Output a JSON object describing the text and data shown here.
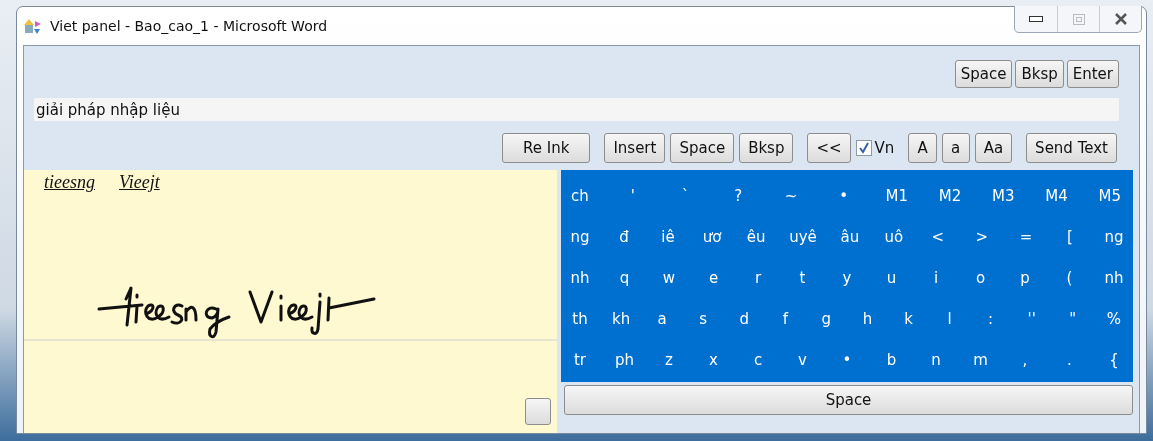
{
  "window": {
    "title": "Viet panel - Bao_cao_1 - Microsoft Word"
  },
  "top_buttons": [
    "Space",
    "Bksp",
    "Enter"
  ],
  "input": {
    "value": "giải pháp nhập liệu"
  },
  "toolbar": [
    [
      {
        "kind": "button",
        "label": "Re Ink"
      }
    ],
    [
      {
        "kind": "button",
        "label": "Insert"
      },
      {
        "kind": "button",
        "label": "Space"
      },
      {
        "kind": "button",
        "label": "Bksp"
      }
    ],
    [
      {
        "kind": "button",
        "label": "<<"
      },
      {
        "kind": "checkbox",
        "label": "Vn",
        "checked": true
      }
    ],
    [
      {
        "kind": "button",
        "label": "A"
      },
      {
        "kind": "button",
        "label": "a"
      },
      {
        "kind": "button",
        "label": "Aa"
      }
    ],
    [
      {
        "kind": "button",
        "label": "Send Text"
      }
    ]
  ],
  "ink_panel": {
    "suggestions": [
      "tieesng",
      "Vieejt"
    ]
  },
  "keyboard": {
    "rows": [
      {
        "keys": [
          "ch",
          "'",
          "`",
          "?",
          "~",
          "•",
          "M1",
          "M2",
          "M3",
          "M4",
          "M5"
        ]
      },
      {
        "keys": [
          "ng",
          "đ",
          "iê",
          "ươ",
          "êu",
          "uyê",
          "âu",
          "uô",
          "<",
          ">",
          "=",
          "[",
          "ng"
        ]
      },
      {
        "keys": [
          "nh",
          "q",
          "w",
          "e",
          "r",
          "t",
          "y",
          "u",
          "i",
          "o",
          "p",
          "(",
          "nh"
        ]
      },
      {
        "keys": [
          "th",
          "kh",
          "a",
          "s",
          "d",
          "f",
          "g",
          "h",
          "k",
          "l",
          ":",
          "''",
          "\"",
          "%"
        ]
      },
      {
        "keys": [
          "tr",
          "ph",
          "z",
          "x",
          "c",
          "v",
          "•",
          "b",
          "n",
          "m",
          ",",
          ".",
          "{"
        ]
      }
    ],
    "space_bar": "Space"
  }
}
